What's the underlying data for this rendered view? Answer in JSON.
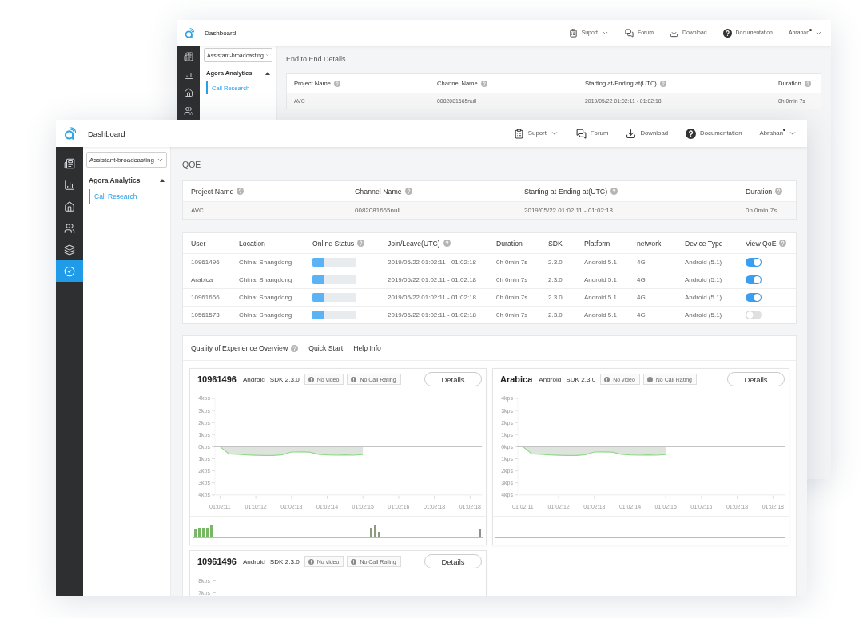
{
  "back_window": {
    "header": {
      "title": "Dashboard",
      "nav": [
        {
          "label": "Suport",
          "menu": true
        },
        {
          "label": "Forum",
          "menu": false
        },
        {
          "label": "Download",
          "menu": false
        },
        {
          "label": "Documentation",
          "menu": false
        }
      ],
      "user": {
        "name": "Abrahan",
        "notification": true
      }
    },
    "sidebar": [
      {
        "selected": false
      },
      {
        "selected": false
      },
      {
        "selected": false
      },
      {
        "selected": false
      }
    ],
    "project_select": "Assistant-broadcasting",
    "nav_group": {
      "label": "Agora Analytics",
      "expanded": true,
      "items": [
        {
          "label": "Call Research",
          "selected": true
        }
      ]
    },
    "section_title": "End to End Details",
    "project_table": {
      "columns": [
        {
          "label": "Project Name",
          "help": true
        },
        {
          "label": "Channel Name",
          "help": true
        },
        {
          "label": "Starting at-Ending at(UTC)",
          "help": true
        },
        {
          "label": "Duration",
          "help": true
        }
      ],
      "rows": [
        [
          "AVC",
          "0082081665null",
          "2019/05/22 01:02:11 - 01:02:18",
          "0h 0min 7s"
        ]
      ]
    }
  },
  "front_window": {
    "header": {
      "title": "Dashboard",
      "nav": [
        {
          "label": "Suport",
          "menu": true
        },
        {
          "label": "Forum",
          "menu": false
        },
        {
          "label": "Download",
          "menu": false
        },
        {
          "label": "Documentation",
          "menu": false
        }
      ],
      "user": {
        "name": "Abrahan",
        "notification": true
      }
    },
    "sidebar": [
      {
        "selected": false
      },
      {
        "selected": false
      },
      {
        "selected": false
      },
      {
        "selected": false
      },
      {
        "selected": false
      },
      {
        "selected": true
      }
    ],
    "project_select": "Assistant-broadcasting",
    "nav_group": {
      "label": "Agora Analytics",
      "expanded": true,
      "items": [
        {
          "label": "Call Research",
          "selected": true
        }
      ]
    },
    "section_title": "QOE",
    "project_table": {
      "columns": [
        {
          "label": "Project Name",
          "help": true
        },
        {
          "label": "Channel Name",
          "help": true
        },
        {
          "label": "Starting at-Ending at(UTC)",
          "help": true
        },
        {
          "label": "Duration",
          "help": true
        }
      ],
      "rows": [
        [
          "AVC",
          "0082081665null",
          "2019/05/22 01:02:11 - 01:02:18",
          "0h 0min 7s"
        ]
      ]
    },
    "users_table": {
      "columns": [
        {
          "label": "User",
          "help": false
        },
        {
          "label": "Location",
          "help": false
        },
        {
          "label": "Online Status",
          "help": true
        },
        {
          "label": "Join/Leave(UTC)",
          "help": true
        },
        {
          "label": "Duration",
          "help": false
        },
        {
          "label": "SDK",
          "help": false
        },
        {
          "label": "Platform",
          "help": false
        },
        {
          "label": "network",
          "help": false
        },
        {
          "label": "Device Type",
          "help": false
        },
        {
          "label": "View QoE",
          "help": true
        }
      ],
      "rows": [
        {
          "user": "10961496",
          "location": "China: Shangdong",
          "online_status": {
            "level": 0.25
          },
          "join_leave": "2019/05/22 01:02:11 - 01:02:18",
          "duration": "0h 0min 7s",
          "sdk": "2.3.0",
          "platform": "Android 5.1",
          "network": "4G",
          "device_type": "Android (5.1)",
          "view_qoe": true
        },
        {
          "user": "Arabica",
          "location": "China: Shangdong",
          "online_status": {
            "level": 0.25
          },
          "join_leave": "2019/05/22 01:02:11 - 01:02:18",
          "duration": "0h 0min 7s",
          "sdk": "2.3.0",
          "platform": "Android 5.1",
          "network": "4G",
          "device_type": "Android (5.1)",
          "view_qoe": true
        },
        {
          "user": "10961666",
          "location": "China: Shangdong",
          "online_status": {
            "level": 0.25
          },
          "join_leave": "2019/05/22 01:02:11 - 01:02:18",
          "duration": "0h 0min 7s",
          "sdk": "2.3.0",
          "platform": "Android 5.1",
          "network": "4G",
          "device_type": "Android (5.1)",
          "view_qoe": true
        },
        {
          "user": "10561573",
          "location": "China: Shangdong",
          "online_status": {
            "level": 0.25
          },
          "join_leave": "2019/05/22 01:02:11 - 01:02:18",
          "duration": "0h 0min 7s",
          "sdk": "2.3.0",
          "platform": "Android 5.1",
          "network": "4G",
          "device_type": "Android (5.1)",
          "view_qoe": false
        }
      ]
    },
    "qoe_panel": {
      "tabs": [
        {
          "label": "Quality of Experience Overview",
          "help": true
        },
        {
          "label": "Quick Start",
          "help": false
        },
        {
          "label": "Help Info",
          "help": false
        }
      ],
      "cards": [
        {
          "user": "10961496",
          "platform": "Android",
          "sdk": "SDK 2.3.0",
          "tags": [
            "No video",
            "No Call Rating"
          ],
          "action": "Details",
          "activity": true,
          "chart_data": {
            "type": "area",
            "categories": [
              "01:02:11",
              null,
              null,
              null,
              "01:02:12",
              null,
              null,
              null,
              "01:02:13",
              null,
              null,
              null,
              "01:02:14",
              null,
              null,
              null,
              "01:02:15",
              null,
              null,
              null,
              "01:02:16",
              null,
              null,
              null,
              "01:02:18",
              null,
              null,
              null,
              "01:02:18"
            ],
            "series": [
              {
                "color": "#8fd98a",
                "values": [
                  0,
                  -0.6,
                  -0.62,
                  -0.68,
                  -0.71,
                  -0.72,
                  -0.72,
                  -0.66,
                  -0.44,
                  -0.43,
                  -0.45,
                  -0.62,
                  -0.68,
                  -0.7,
                  -0.68,
                  -0.7,
                  -0.64,
                  null,
                  null,
                  null,
                  null,
                  null,
                  null,
                  null,
                  null,
                  null,
                  null,
                  null,
                  null
                ]
              }
            ],
            "ylim": [
              -4,
              4
            ],
            "yticks": [
              {
                "value": 4,
                "label": "4kps"
              },
              {
                "value": 3,
                "label": "3kps"
              },
              {
                "value": 2,
                "label": "2kps"
              },
              {
                "value": 1,
                "label": "1kps"
              },
              {
                "value": 0,
                "label": "0kps"
              },
              {
                "value": -1,
                "label": "1kps"
              },
              {
                "value": -2,
                "label": "2kps"
              },
              {
                "value": -3,
                "label": "3kps"
              },
              {
                "value": -4,
                "label": "4kps"
              }
            ]
          }
        },
        {
          "user": "Arabica",
          "platform": "Android",
          "sdk": "SDK 2.3.0",
          "tags": [
            "No video",
            "No Call Rating"
          ],
          "action": "Details",
          "activity": false,
          "chart_data": {
            "type": "area",
            "categories": [
              "01:02:11",
              null,
              null,
              null,
              "01:02:12",
              null,
              null,
              null,
              "01:02:13",
              null,
              null,
              null,
              "01:02:14",
              null,
              null,
              null,
              "01:02:15",
              null,
              null,
              null,
              "01:02:16",
              null,
              null,
              null,
              "01:02:18",
              null,
              null,
              null,
              "01:02:18"
            ],
            "series": [
              {
                "color": "#8fd98a",
                "values": [
                  0,
                  -0.6,
                  -0.62,
                  -0.68,
                  -0.71,
                  -0.72,
                  -0.72,
                  -0.66,
                  -0.44,
                  -0.43,
                  -0.45,
                  -0.62,
                  -0.68,
                  -0.7,
                  -0.68,
                  -0.7,
                  -0.64,
                  null,
                  null,
                  null,
                  null,
                  null,
                  null,
                  null,
                  null,
                  null,
                  null,
                  null,
                  null
                ]
              }
            ],
            "ylim": [
              -4,
              4
            ],
            "yticks": [
              {
                "value": 4,
                "label": "4kps"
              },
              {
                "value": 3,
                "label": "3kps"
              },
              {
                "value": 2,
                "label": "2kps"
              },
              {
                "value": 1,
                "label": "1kps"
              },
              {
                "value": 0,
                "label": "0kps"
              },
              {
                "value": -1,
                "label": "1kps"
              },
              {
                "value": -2,
                "label": "2kps"
              },
              {
                "value": -3,
                "label": "3kps"
              },
              {
                "value": -4,
                "label": "4kps"
              }
            ]
          }
        },
        {
          "user": "10961496",
          "platform": "Android",
          "sdk": "SDK 2.3.0",
          "tags": [
            "No video",
            "No Call Rating"
          ],
          "action": "Details",
          "y_axis_labels": [
            "8kps",
            "7kps"
          ]
        }
      ]
    }
  }
}
